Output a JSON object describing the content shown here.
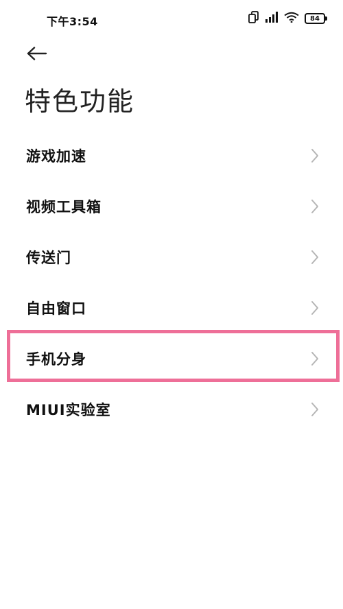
{
  "status_bar": {
    "time": "下午3:54",
    "battery": "84"
  },
  "header": {
    "title": "特色功能"
  },
  "menu": {
    "items": [
      {
        "label": "游戏加速"
      },
      {
        "label": "视频工具箱"
      },
      {
        "label": "传送门"
      },
      {
        "label": "自由窗口"
      },
      {
        "label": "手机分身"
      },
      {
        "label": "MIUI实验室"
      }
    ]
  },
  "colors": {
    "highlight": "#ee6f98",
    "chevron": "#b5b5b5"
  },
  "icons": {
    "back": "arrow-left-icon",
    "chevron": "chevron-right-icon",
    "sim": "dual-sim-icon",
    "signal": "signal-bars-icon",
    "wifi": "wifi-icon",
    "battery": "battery-icon"
  }
}
